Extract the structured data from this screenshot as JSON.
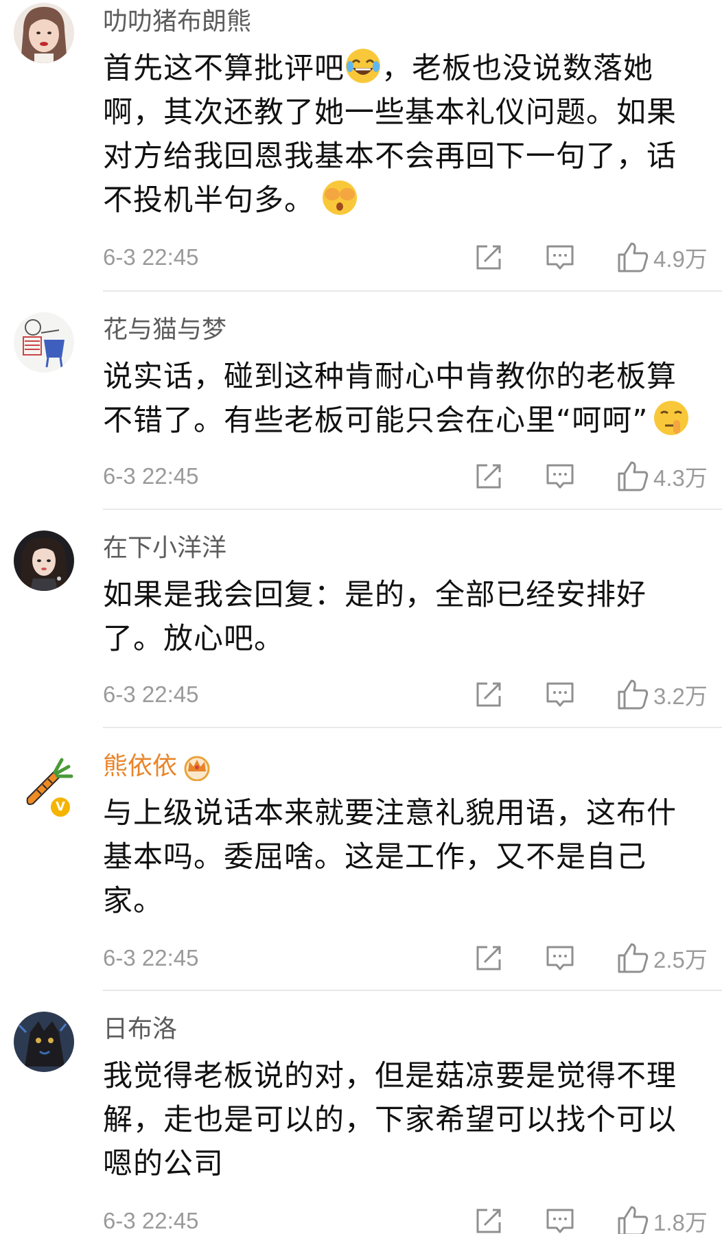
{
  "comments": [
    {
      "username": "叻叻猪布朗熊",
      "text_parts": [
        "首先这不算批评吧",
        "，老板也没说数落她啊，其次还教了她一些基本礼仪问题。如果对方给我回恩我基本不会再回下一句了，话不投机半句多。"
      ],
      "emojis": [
        "laughing-tears-emoji",
        "cover-eyes-emoji"
      ],
      "time": "6-3 22:45",
      "likes": "4.9万"
    },
    {
      "username": "花与猫与梦",
      "text_parts": [
        "说实话，碰到这种肯耐心中肯教你的老板算不错了。有些老板可能只会在心里“呵呵”"
      ],
      "emojis": [
        "shush-emoji"
      ],
      "time": "6-3 22:45",
      "likes": "4.3万"
    },
    {
      "username": "在下小洋洋",
      "text_parts": [
        "如果是我会回复：是的，全部已经安排好了。放心吧。"
      ],
      "time": "6-3 22:45",
      "likes": "3.2万"
    },
    {
      "username": "熊依依",
      "badge": "V",
      "icons": [
        "crown-icon"
      ],
      "text_parts": [
        "与上级说话本来就要注意礼貌用语，这布什基本吗。委屈啥。这是工作，又不是自己家。"
      ],
      "time": "6-3 22:45",
      "likes": "2.5万"
    },
    {
      "username": "日布洛",
      "text_parts": [
        "我觉得老板说的对，但是菇凉要是觉得不理解，走也是可以的，下家希望可以找个可以嗯的公司"
      ],
      "time": "6-3 22:45",
      "likes": "1.8万"
    }
  ],
  "colors": {
    "username": "#5c5c5c",
    "username_member": "#e8842a",
    "meta": "#9a9a9a",
    "divider": "#e8e8e8",
    "badge": "#f5b400"
  }
}
